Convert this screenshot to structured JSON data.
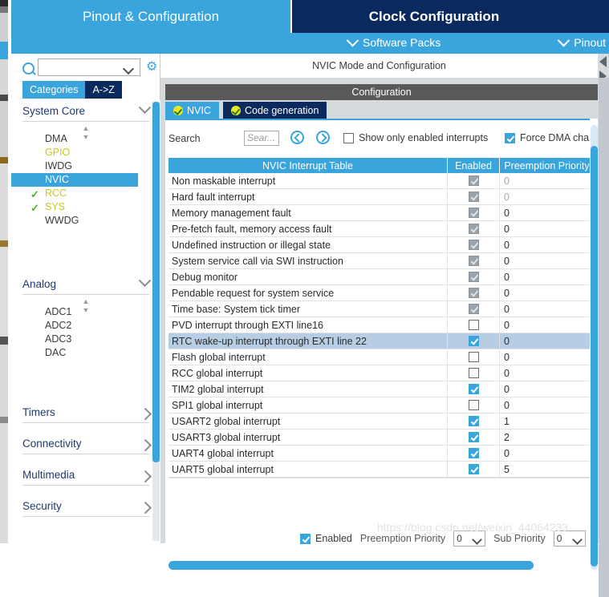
{
  "top_tabs": [
    {
      "label": "Pinout & Configuration",
      "active": false
    },
    {
      "label": "Clock Configuration",
      "active": true
    }
  ],
  "second_bar": {
    "software_packs": "Software Packs",
    "pinout": "Pinout"
  },
  "sidebar": {
    "search_placeholder": "",
    "search_value": "",
    "gear_icon": "gear-icon",
    "tabs": [
      {
        "label": "Categories",
        "active": true
      },
      {
        "label": "A->Z",
        "active": false
      }
    ],
    "groups": [
      {
        "title": "System Core",
        "expanded": true,
        "items": [
          {
            "label": "DMA",
            "state": "normal",
            "check": false,
            "selected": false
          },
          {
            "label": "GPIO",
            "state": "warn",
            "check": false,
            "selected": false
          },
          {
            "label": "IWDG",
            "state": "normal",
            "check": false,
            "selected": false
          },
          {
            "label": "NVIC",
            "state": "normal",
            "check": false,
            "selected": true
          },
          {
            "label": "RCC",
            "state": "warn",
            "check": true,
            "selected": false
          },
          {
            "label": "SYS",
            "state": "warn",
            "check": true,
            "selected": false
          },
          {
            "label": "WWDG",
            "state": "normal",
            "check": false,
            "selected": false
          }
        ]
      },
      {
        "title": "Analog",
        "expanded": true,
        "items": [
          {
            "label": "ADC1",
            "state": "normal",
            "check": false,
            "selected": false
          },
          {
            "label": "ADC2",
            "state": "normal",
            "check": false,
            "selected": false
          },
          {
            "label": "ADC3",
            "state": "normal",
            "check": false,
            "selected": false
          },
          {
            "label": "DAC",
            "state": "normal",
            "check": false,
            "selected": false
          }
        ]
      },
      {
        "title": "Timers",
        "expanded": false,
        "items": []
      },
      {
        "title": "Connectivity",
        "expanded": false,
        "items": []
      },
      {
        "title": "Multimedia",
        "expanded": false,
        "items": []
      },
      {
        "title": "Security",
        "expanded": false,
        "items": []
      }
    ]
  },
  "main": {
    "mode_header": "NVIC Mode and Configuration",
    "config_bar": "Configuration",
    "tabs": [
      {
        "label": "NVIC",
        "active": true
      },
      {
        "label": "Code generation",
        "active": false
      }
    ],
    "toolbar": {
      "search_label": "Search",
      "search_placeholder": "Sear...",
      "search_value": "",
      "prev_icon": "chevron-left-circle-icon",
      "next_icon": "chevron-right-circle-icon",
      "show_only_enabled": {
        "label": "Show only enabled interrupts",
        "checked": false
      },
      "force_dma": {
        "label": "Force DMA cha",
        "checked": true
      }
    },
    "table": {
      "headers": [
        "NVIC Interrupt Table",
        "Enabled",
        "Preemption Priority"
      ],
      "rows": [
        {
          "name": "Non maskable interrupt",
          "enabled": true,
          "locked": true,
          "priority": "0",
          "selected": false
        },
        {
          "name": "Hard fault interrupt",
          "enabled": true,
          "locked": true,
          "priority": "0",
          "selected": false
        },
        {
          "name": "Memory management fault",
          "enabled": true,
          "locked": true,
          "priority": "0",
          "selected": false
        },
        {
          "name": "Pre-fetch fault, memory access fault",
          "enabled": true,
          "locked": true,
          "priority": "0",
          "selected": false
        },
        {
          "name": "Undefined instruction or illegal state",
          "enabled": true,
          "locked": true,
          "priority": "0",
          "selected": false
        },
        {
          "name": "System service call via SWI instruction",
          "enabled": true,
          "locked": true,
          "priority": "0",
          "selected": false
        },
        {
          "name": "Debug monitor",
          "enabled": true,
          "locked": true,
          "priority": "0",
          "selected": false
        },
        {
          "name": "Pendable request for system service",
          "enabled": true,
          "locked": true,
          "priority": "0",
          "selected": false
        },
        {
          "name": "Time base: System tick timer",
          "enabled": true,
          "locked": true,
          "priority": "0",
          "selected": false
        },
        {
          "name": "PVD interrupt through EXTI line16",
          "enabled": false,
          "locked": false,
          "priority": "0",
          "selected": false
        },
        {
          "name": "RTC wake-up interrupt through EXTI line 22",
          "enabled": true,
          "locked": false,
          "priority": "0",
          "selected": true
        },
        {
          "name": "Flash global interrupt",
          "enabled": false,
          "locked": false,
          "priority": "0",
          "selected": false
        },
        {
          "name": "RCC global interrupt",
          "enabled": false,
          "locked": false,
          "priority": "0",
          "selected": false
        },
        {
          "name": "TIM2 global interrupt",
          "enabled": true,
          "locked": false,
          "priority": "0",
          "selected": false
        },
        {
          "name": "SPI1 global interrupt",
          "enabled": false,
          "locked": false,
          "priority": "0",
          "selected": false
        },
        {
          "name": "USART2 global interrupt",
          "enabled": true,
          "locked": false,
          "priority": "1",
          "selected": false
        },
        {
          "name": "USART3 global interrupt",
          "enabled": true,
          "locked": false,
          "priority": "2",
          "selected": false
        },
        {
          "name": "UART4 global interrupt",
          "enabled": true,
          "locked": false,
          "priority": "0",
          "selected": false
        },
        {
          "name": "UART5 global interrupt",
          "enabled": true,
          "locked": false,
          "priority": "5",
          "selected": false
        }
      ]
    },
    "footer": {
      "enabled": {
        "label": "Enabled",
        "checked": true
      },
      "preemption_priority": {
        "label": "Preemption Priority",
        "value": "0"
      },
      "sub_priority": {
        "label": "Sub Priority",
        "value": "0"
      }
    }
  },
  "watermark": "https://blog.csdn.net/weixin_44064233",
  "colors": {
    "accent_blue": "#3aa5dc",
    "navy": "#0a2a5e",
    "selection": "#b6cde3",
    "warn_yellow": "#c8c819",
    "check_green": "#4fb040"
  }
}
